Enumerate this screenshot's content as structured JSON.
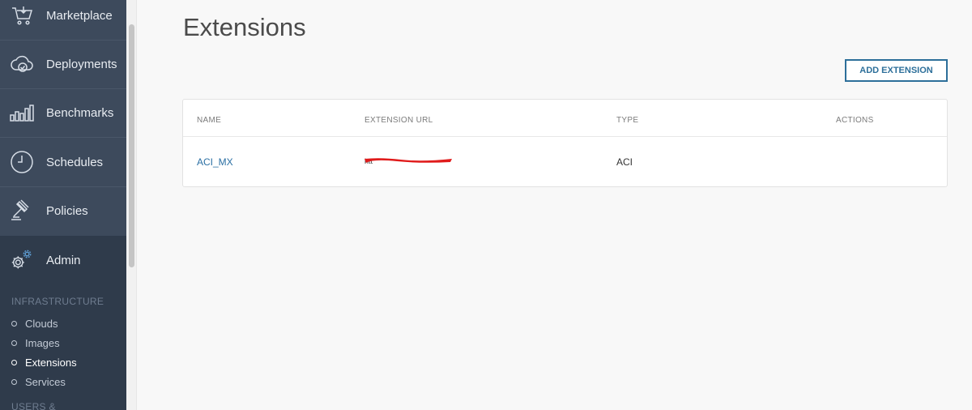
{
  "sidebar": {
    "items": [
      {
        "label": "Marketplace",
        "icon": "cart-icon"
      },
      {
        "label": "Deployments",
        "icon": "cloud-check-icon"
      },
      {
        "label": "Benchmarks",
        "icon": "bar-chart-icon"
      },
      {
        "label": "Schedules",
        "icon": "clock-icon"
      },
      {
        "label": "Policies",
        "icon": "gavel-icon"
      },
      {
        "label": "Admin",
        "icon": "gear-icon"
      }
    ],
    "infrastructure_heading": "INFRASTRUCTURE",
    "sub_items": [
      {
        "label": "Clouds"
      },
      {
        "label": "Images"
      },
      {
        "label": "Extensions"
      },
      {
        "label": "Services"
      }
    ],
    "users_heading": "USERS & PERMISSIONS"
  },
  "main": {
    "title": "Extensions",
    "add_button_label": "ADD EXTENSION",
    "table": {
      "headers": [
        "NAME",
        "EXTENSION URL",
        "TYPE",
        "ACTIONS"
      ],
      "rows": [
        {
          "name": "ACI_MX",
          "url": "htt",
          "type": "ACI"
        }
      ]
    }
  },
  "colors": {
    "sidebar_bg": "#3d4a5c",
    "sidebar_active_bg": "#2f3b4b",
    "accent": "#2d6f9a",
    "link": "#2a6fa3",
    "redaction": "#e01b1b"
  }
}
